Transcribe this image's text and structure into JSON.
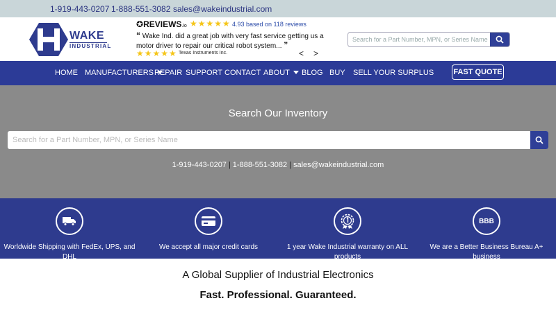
{
  "topbar": {
    "phone1": "1-919-443-0207",
    "phone2": "1-888-551-3082",
    "email": "sales@wakeindustrial.com"
  },
  "logo": {
    "word1": "WAKE",
    "word2": "INDUSTRIAL"
  },
  "reviews": {
    "brand": "REVIEWS",
    "brand_suffix": ".io",
    "stars": "★★★★★",
    "rating_text": "4.93 based on 118 reviews",
    "quote": "Wake Ind. did a great job with very fast service getting us a motor driver to repair our critical robot system...",
    "reviewer": "Texas Instruments Inc.",
    "prev": "<",
    "next": ">"
  },
  "header_search": {
    "placeholder": "Search for a Part Number, MPN, or Series Name"
  },
  "nav": {
    "items": [
      "HOME",
      "MANUFACTURERS",
      "REPAIR",
      "SUPPORT",
      "CONTACT",
      "ABOUT",
      "BLOG",
      "BUY",
      "SELL YOUR SURPLUS"
    ],
    "cta": "FAST QUOTE"
  },
  "inventory": {
    "title": "Search Our Inventory",
    "placeholder": "Search for a Part Number, MPN, or Series Name",
    "phone1": "1-919-443-0207",
    "phone2": "1-888-551-3082",
    "email": "sales@wakeindustrial.com",
    "separator": "|"
  },
  "features": [
    {
      "icon": "truck-icon",
      "label": "Worldwide Shipping with FedEx, UPS, and DHL"
    },
    {
      "icon": "credit-card-icon",
      "label": "We accept all major credit cards"
    },
    {
      "icon": "warranty-badge-icon",
      "label": "1 year Wake Industrial warranty on ALL products"
    },
    {
      "icon": "bbb-icon",
      "icon_text": "BBB",
      "label": "We are a Better Business Bureau A+ business"
    }
  ],
  "tagline": "A Global Supplier of Industrial Electronics",
  "tagline2": "Fast. Professional. Guaranteed.",
  "colors": {
    "brand_blue": "#2c3b97",
    "topbar": "#c9d6d9",
    "inventory_bg": "#8a8a8a",
    "star": "#f5c518"
  }
}
